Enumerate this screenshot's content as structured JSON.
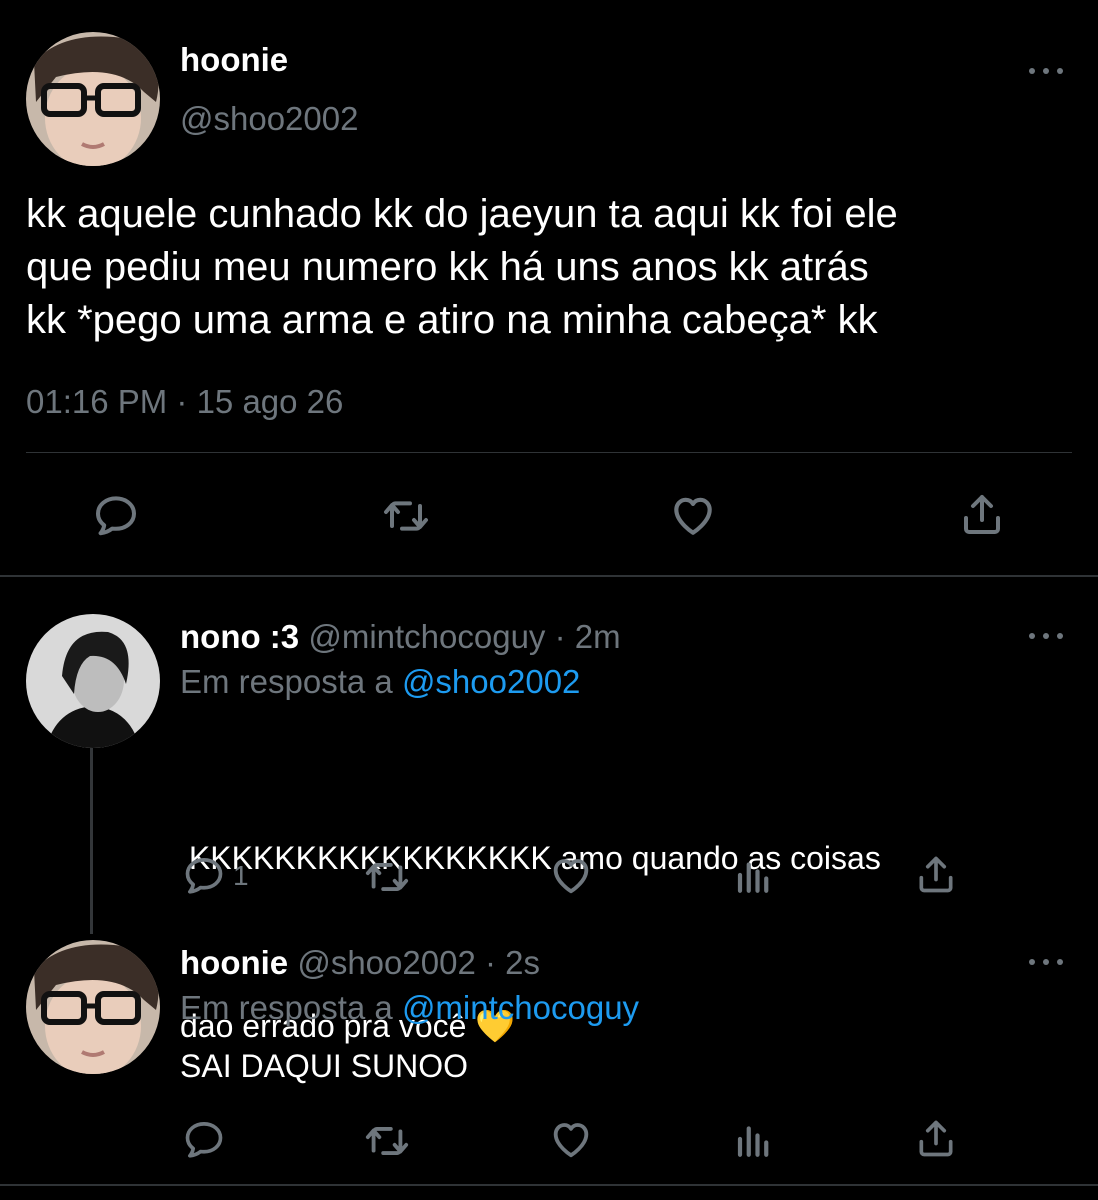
{
  "main_tweet": {
    "display_name": "hoonie",
    "handle": "@shoo2002",
    "lines": [
      "kk aquele cunhado kk do jaeyun ta aqui kk foi ele",
      "que pediu meu numero kk há uns anos kk atrás",
      "kk *pego uma arma e atiro na minha cabeça* kk"
    ],
    "timestamp": "01:16 PM · 15 ago 26",
    "actions": [
      "reply-icon",
      "retweet-icon",
      "like-icon",
      "share-icon"
    ]
  },
  "reply1": {
    "display_name": "nono :3",
    "handle": "@mintchocoguy",
    "time": "· 2m",
    "reply_prefix": "Em resposta a",
    "reply_to": "@shoo2002",
    "line1": " KKKKKKKKKKKKKKKKK amo quando as coisas",
    "line2": "dao errado pra você 💛",
    "reply_count": "1",
    "actions": [
      "reply-icon",
      "retweet-icon",
      "like-icon",
      "analytics-icon",
      "share-icon"
    ]
  },
  "reply2": {
    "display_name": "hoonie",
    "handle": "@shoo2002",
    "time": "· 2s",
    "reply_prefix": "Em resposta a",
    "reply_to": "@mintchocoguy",
    "text": "SAI DAQUI SUNOO",
    "actions": [
      "reply-icon",
      "retweet-icon",
      "like-icon",
      "analytics-icon",
      "share-icon"
    ]
  },
  "colors": {
    "background": "#000000",
    "text": "#ffffff",
    "muted": "#6e767d",
    "link": "#1d9bf0",
    "divider": "#2f3336"
  }
}
